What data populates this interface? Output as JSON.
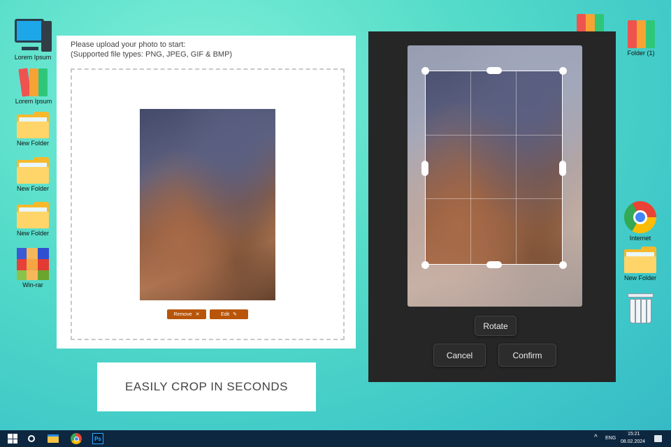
{
  "desktop_left": [
    {
      "label": "Lorem Ipsum",
      "icon": "computer-icon"
    },
    {
      "label": "Lorem Ipsum",
      "icon": "binders-icon"
    },
    {
      "label": "New Folder",
      "icon": "folder-icon"
    },
    {
      "label": "New Folder",
      "icon": "folder-icon"
    },
    {
      "label": "New Folder",
      "icon": "folder-icon"
    },
    {
      "label": "Win-rar",
      "icon": "winrar-icon"
    }
  ],
  "desktop_right": [
    {
      "label": "Folder (1)",
      "icon": "binders-icon"
    },
    {
      "label": "Internet",
      "icon": "chrome-icon"
    },
    {
      "label": "New Folder",
      "icon": "folder-icon"
    },
    {
      "label": "",
      "icon": "recycle-bin-icon"
    }
  ],
  "upload": {
    "line1": "Please upload your photo to start:",
    "line2": "(Supported file types: PNG, JPEG, GIF & BMP)",
    "remove": "Remove",
    "remove_glyph": "✕",
    "edit": "Edit",
    "edit_glyph": "✎"
  },
  "caption": "EASILY CROP IN SECONDS",
  "cropper": {
    "rotate": "Rotate",
    "cancel": "Cancel",
    "confirm": "Confirm"
  },
  "taskbar": {
    "lang": "ENG",
    "time": "15:21",
    "date": "08.02.2024",
    "ps_label": "Ps"
  }
}
